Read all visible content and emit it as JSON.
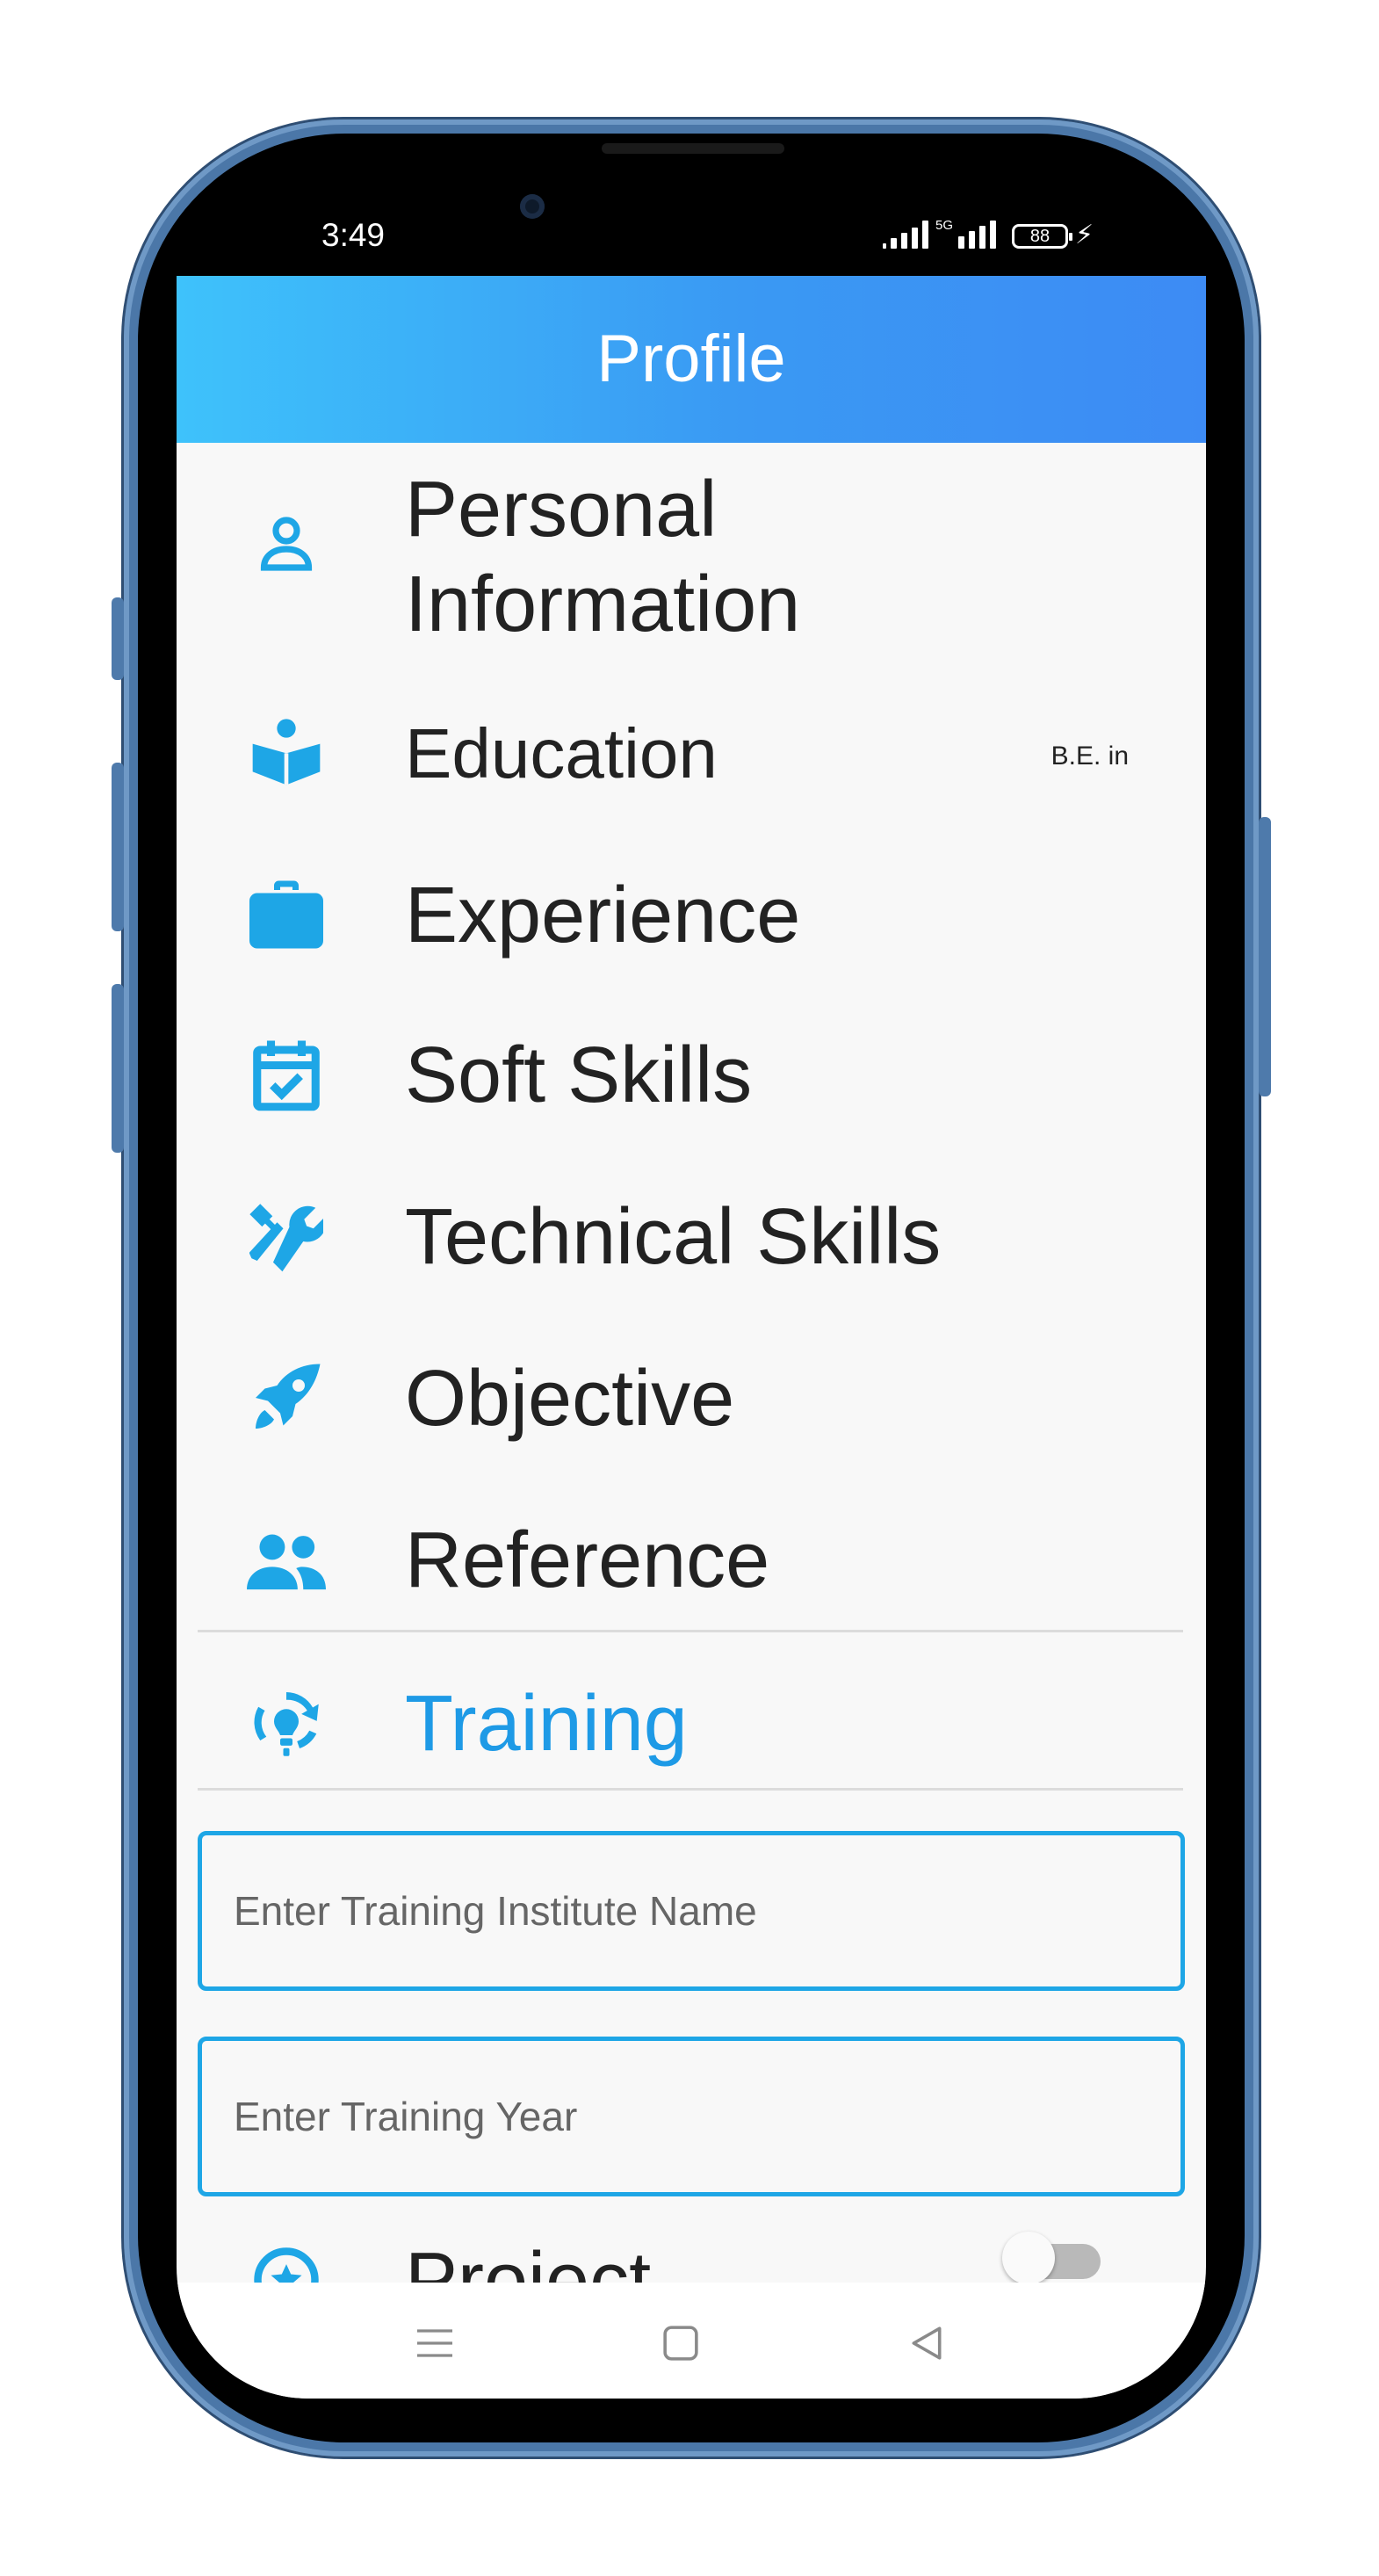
{
  "status_bar": {
    "time": "3:49",
    "network": "5G",
    "battery": "88"
  },
  "app_bar": {
    "title": "Profile",
    "gradient": [
      "#3ec2fb",
      "#3d8bf4"
    ]
  },
  "accent_color": "#1ea6e6",
  "sections": [
    {
      "icon": "person-icon",
      "label": "Personal Information",
      "trailing": ""
    },
    {
      "icon": "book-reader-icon",
      "label": "Education",
      "trailing": "B.E. in"
    },
    {
      "icon": "briefcase-icon",
      "label": "Experience",
      "trailing": ""
    },
    {
      "icon": "calendar-check-icon",
      "label": "Soft Skills",
      "trailing": ""
    },
    {
      "icon": "tools-icon",
      "label": "Technical Skills",
      "trailing": ""
    },
    {
      "icon": "rocket-icon",
      "label": "Objective",
      "trailing": ""
    },
    {
      "icon": "people-icon",
      "label": "Reference",
      "trailing": ""
    },
    {
      "icon": "training-icon",
      "label": "Training",
      "trailing": "",
      "expanded": true
    },
    {
      "icon": "star-circle-icon",
      "label": "Project",
      "trailing": "",
      "toggle": false
    }
  ],
  "personal_info_lines": [
    "Personal",
    "Information"
  ],
  "training_form": {
    "institute_placeholder": "Enter Training Institute Name",
    "year_placeholder": "Enter Training Year"
  },
  "nav_bar": {
    "buttons": [
      "menu-icon",
      "home-square-icon",
      "back-triangle-icon"
    ]
  }
}
